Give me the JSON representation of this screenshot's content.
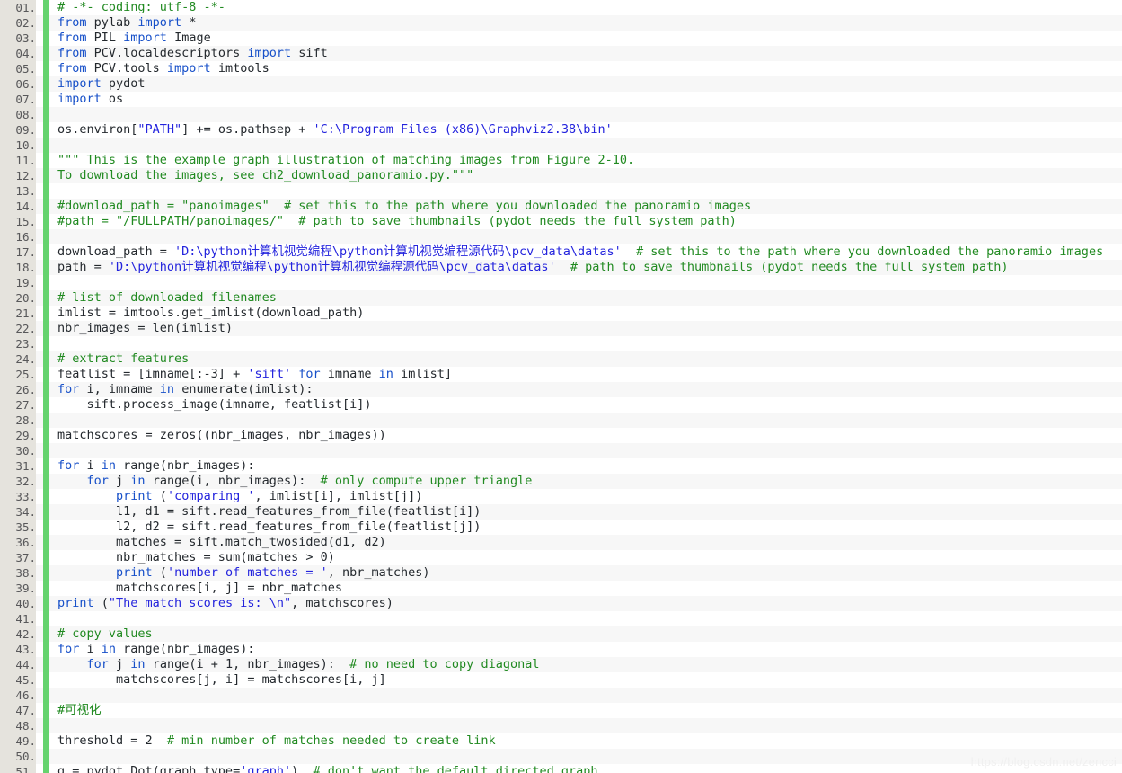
{
  "editor": {
    "language": "Python",
    "gutter_color": "#e5e3dd",
    "marker_color": "#65d36e",
    "row_color": "#ffffff",
    "row_alt_color": "#f7f7f7",
    "comment_color": "#218a21",
    "string_color": "#2323dd",
    "keyword_color": "#1750c9",
    "text_color": "#24292e",
    "first_line": 1,
    "last_line": 51,
    "total_lines": 51
  },
  "watermark": {
    "text": "https://blog.csdn.net/zencci"
  },
  "lines": [
    {
      "n": "01.",
      "tokens": [
        {
          "c": "com",
          "t": "# -*- coding: utf-8 -*-"
        }
      ]
    },
    {
      "n": "02.",
      "tokens": [
        {
          "c": "kw",
          "t": "from"
        },
        {
          "c": "pln",
          "t": " pylab "
        },
        {
          "c": "kw",
          "t": "import"
        },
        {
          "c": "pln",
          "t": " *"
        }
      ]
    },
    {
      "n": "03.",
      "tokens": [
        {
          "c": "kw",
          "t": "from"
        },
        {
          "c": "pln",
          "t": " PIL "
        },
        {
          "c": "kw",
          "t": "import"
        },
        {
          "c": "pln",
          "t": " Image"
        }
      ]
    },
    {
      "n": "04.",
      "tokens": [
        {
          "c": "kw",
          "t": "from"
        },
        {
          "c": "pln",
          "t": " PCV.localdescriptors "
        },
        {
          "c": "kw",
          "t": "import"
        },
        {
          "c": "pln",
          "t": " sift"
        }
      ]
    },
    {
      "n": "05.",
      "tokens": [
        {
          "c": "kw",
          "t": "from"
        },
        {
          "c": "pln",
          "t": " PCV.tools "
        },
        {
          "c": "kw",
          "t": "import"
        },
        {
          "c": "pln",
          "t": " imtools"
        }
      ]
    },
    {
      "n": "06.",
      "tokens": [
        {
          "c": "kw",
          "t": "import"
        },
        {
          "c": "pln",
          "t": " pydot"
        }
      ]
    },
    {
      "n": "07.",
      "tokens": [
        {
          "c": "kw",
          "t": "import"
        },
        {
          "c": "pln",
          "t": " os"
        }
      ]
    },
    {
      "n": "08.",
      "tokens": []
    },
    {
      "n": "09.",
      "tokens": [
        {
          "c": "pln",
          "t": "os.environ["
        },
        {
          "c": "str",
          "t": "\"PATH\""
        },
        {
          "c": "pln",
          "t": "] += os.pathsep + "
        },
        {
          "c": "str",
          "t": "'C:\\Program Files (x86)\\Graphviz2.38\\bin'"
        }
      ]
    },
    {
      "n": "10.",
      "tokens": []
    },
    {
      "n": "11.",
      "tokens": [
        {
          "c": "com",
          "t": "\"\"\" This is the example graph illustration of matching images from Figure 2-10."
        }
      ]
    },
    {
      "n": "12.",
      "tokens": [
        {
          "c": "com",
          "t": "To download the images, see ch2_download_panoramio.py.\"\"\""
        }
      ]
    },
    {
      "n": "13.",
      "tokens": []
    },
    {
      "n": "14.",
      "tokens": [
        {
          "c": "com",
          "t": "#download_path = \"panoimages\"  # set this to the path where you downloaded the panoramio images"
        }
      ]
    },
    {
      "n": "15.",
      "tokens": [
        {
          "c": "com",
          "t": "#path = \"/FULLPATH/panoimages/\"  # path to save thumbnails (pydot needs the full system path)"
        }
      ]
    },
    {
      "n": "16.",
      "tokens": []
    },
    {
      "n": "17.",
      "tokens": [
        {
          "c": "pln",
          "t": "download_path = "
        },
        {
          "c": "str",
          "t": "'D:\\python计算机视觉编程\\python计算机视觉编程源代码\\pcv_data\\datas'"
        },
        {
          "c": "com",
          "t": "  # set this to the path where you downloaded the panoramio images"
        }
      ]
    },
    {
      "n": "18.",
      "tokens": [
        {
          "c": "pln",
          "t": "path = "
        },
        {
          "c": "str",
          "t": "'D:\\python计算机视觉编程\\python计算机视觉编程源代码\\pcv_data\\datas'"
        },
        {
          "c": "com",
          "t": "  # path to save thumbnails (pydot needs the full system path)"
        }
      ]
    },
    {
      "n": "19.",
      "tokens": []
    },
    {
      "n": "20.",
      "tokens": [
        {
          "c": "com",
          "t": "# list of downloaded filenames"
        }
      ]
    },
    {
      "n": "21.",
      "tokens": [
        {
          "c": "pln",
          "t": "imlist = imtools.get_imlist(download_path)"
        }
      ]
    },
    {
      "n": "22.",
      "tokens": [
        {
          "c": "pln",
          "t": "nbr_images = len(imlist)"
        }
      ]
    },
    {
      "n": "23.",
      "tokens": []
    },
    {
      "n": "24.",
      "tokens": [
        {
          "c": "com",
          "t": "# extract features"
        }
      ]
    },
    {
      "n": "25.",
      "tokens": [
        {
          "c": "pln",
          "t": "featlist = [imname[:-3] + "
        },
        {
          "c": "str",
          "t": "'sift'"
        },
        {
          "c": "pln",
          "t": " "
        },
        {
          "c": "kw",
          "t": "for"
        },
        {
          "c": "pln",
          "t": " imname "
        },
        {
          "c": "kw",
          "t": "in"
        },
        {
          "c": "pln",
          "t": " imlist]"
        }
      ]
    },
    {
      "n": "26.",
      "tokens": [
        {
          "c": "kw",
          "t": "for"
        },
        {
          "c": "pln",
          "t": " i, imname "
        },
        {
          "c": "kw",
          "t": "in"
        },
        {
          "c": "pln",
          "t": " enumerate(imlist):"
        }
      ]
    },
    {
      "n": "27.",
      "tokens": [
        {
          "c": "pln",
          "t": "    sift.process_image(imname, featlist[i])"
        }
      ]
    },
    {
      "n": "28.",
      "tokens": []
    },
    {
      "n": "29.",
      "tokens": [
        {
          "c": "pln",
          "t": "matchscores = zeros((nbr_images, nbr_images))"
        }
      ]
    },
    {
      "n": "30.",
      "tokens": []
    },
    {
      "n": "31.",
      "tokens": [
        {
          "c": "kw",
          "t": "for"
        },
        {
          "c": "pln",
          "t": " i "
        },
        {
          "c": "kw",
          "t": "in"
        },
        {
          "c": "pln",
          "t": " range(nbr_images):"
        }
      ]
    },
    {
      "n": "32.",
      "tokens": [
        {
          "c": "pln",
          "t": "    "
        },
        {
          "c": "kw",
          "t": "for"
        },
        {
          "c": "pln",
          "t": " j "
        },
        {
          "c": "kw",
          "t": "in"
        },
        {
          "c": "pln",
          "t": " range(i, nbr_images):  "
        },
        {
          "c": "com",
          "t": "# only compute upper triangle"
        }
      ]
    },
    {
      "n": "33.",
      "tokens": [
        {
          "c": "pln",
          "t": "        "
        },
        {
          "c": "kw",
          "t": "print"
        },
        {
          "c": "pln",
          "t": " ("
        },
        {
          "c": "str",
          "t": "'comparing '"
        },
        {
          "c": "pln",
          "t": ", imlist[i], imlist[j])"
        }
      ]
    },
    {
      "n": "34.",
      "tokens": [
        {
          "c": "pln",
          "t": "        l1, d1 = sift.read_features_from_file(featlist[i])"
        }
      ]
    },
    {
      "n": "35.",
      "tokens": [
        {
          "c": "pln",
          "t": "        l2, d2 = sift.read_features_from_file(featlist[j])"
        }
      ]
    },
    {
      "n": "36.",
      "tokens": [
        {
          "c": "pln",
          "t": "        matches = sift.match_twosided(d1, d2)"
        }
      ]
    },
    {
      "n": "37.",
      "tokens": [
        {
          "c": "pln",
          "t": "        nbr_matches = sum(matches > 0)"
        }
      ]
    },
    {
      "n": "38.",
      "tokens": [
        {
          "c": "pln",
          "t": "        "
        },
        {
          "c": "kw",
          "t": "print"
        },
        {
          "c": "pln",
          "t": " ("
        },
        {
          "c": "str",
          "t": "'number of matches = '"
        },
        {
          "c": "pln",
          "t": ", nbr_matches)"
        }
      ]
    },
    {
      "n": "39.",
      "tokens": [
        {
          "c": "pln",
          "t": "        matchscores[i, j] = nbr_matches"
        }
      ]
    },
    {
      "n": "40.",
      "tokens": [
        {
          "c": "kw",
          "t": "print"
        },
        {
          "c": "pln",
          "t": " ("
        },
        {
          "c": "str",
          "t": "\"The match scores is: \\n\""
        },
        {
          "c": "pln",
          "t": ", matchscores)"
        }
      ]
    },
    {
      "n": "41.",
      "tokens": []
    },
    {
      "n": "42.",
      "tokens": [
        {
          "c": "com",
          "t": "# copy values"
        }
      ]
    },
    {
      "n": "43.",
      "tokens": [
        {
          "c": "kw",
          "t": "for"
        },
        {
          "c": "pln",
          "t": " i "
        },
        {
          "c": "kw",
          "t": "in"
        },
        {
          "c": "pln",
          "t": " range(nbr_images):"
        }
      ]
    },
    {
      "n": "44.",
      "tokens": [
        {
          "c": "pln",
          "t": "    "
        },
        {
          "c": "kw",
          "t": "for"
        },
        {
          "c": "pln",
          "t": " j "
        },
        {
          "c": "kw",
          "t": "in"
        },
        {
          "c": "pln",
          "t": " range(i + 1, nbr_images):  "
        },
        {
          "c": "com",
          "t": "# no need to copy diagonal"
        }
      ]
    },
    {
      "n": "45.",
      "tokens": [
        {
          "c": "pln",
          "t": "        matchscores[j, i] = matchscores[i, j]"
        }
      ]
    },
    {
      "n": "46.",
      "tokens": []
    },
    {
      "n": "47.",
      "tokens": [
        {
          "c": "com",
          "t": "#可视化"
        }
      ]
    },
    {
      "n": "48.",
      "tokens": []
    },
    {
      "n": "49.",
      "tokens": [
        {
          "c": "pln",
          "t": "threshold = 2  "
        },
        {
          "c": "com",
          "t": "# min number of matches needed to create link"
        }
      ]
    },
    {
      "n": "50.",
      "tokens": []
    },
    {
      "n": "51.",
      "tokens": [
        {
          "c": "pln",
          "t": "g = pydot.Dot(graph_type="
        },
        {
          "c": "str",
          "t": "'graph'"
        },
        {
          "c": "pln",
          "t": ")  "
        },
        {
          "c": "com",
          "t": "# don't want the default directed graph"
        }
      ]
    }
  ]
}
